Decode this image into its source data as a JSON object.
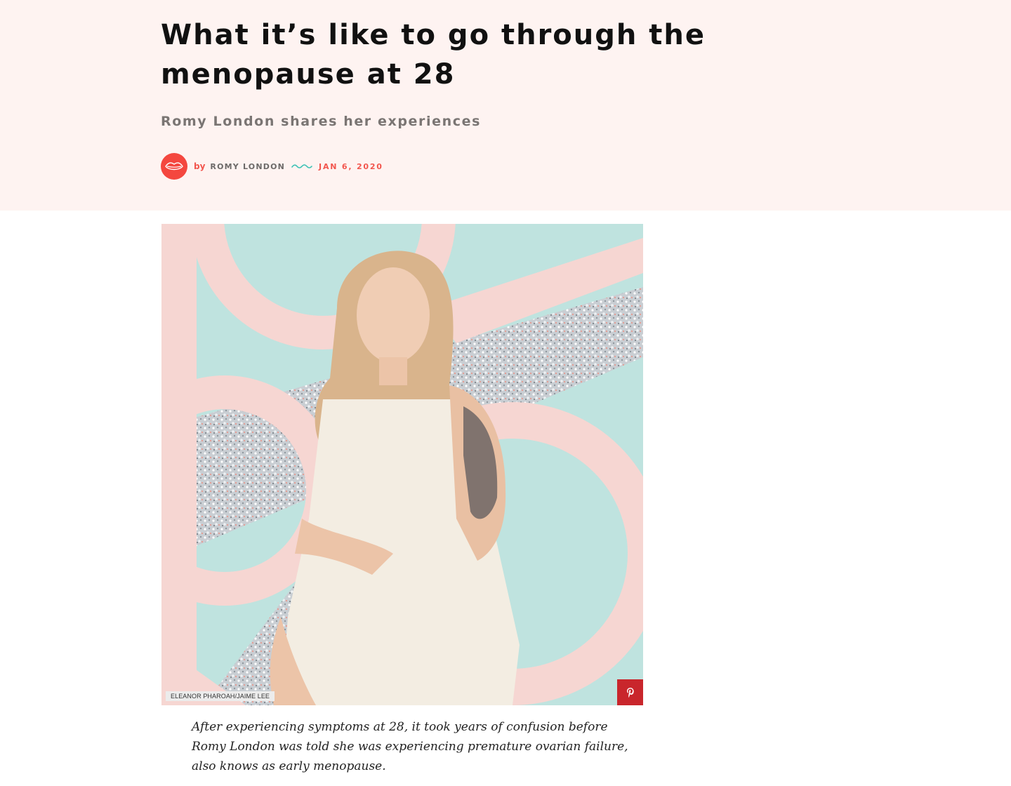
{
  "article": {
    "title": "What it’s like to go through the menopause at 28",
    "subtitle": "Romy London shares her experiences",
    "byline": {
      "by": "by",
      "author": "ROMY LONDON",
      "date": "JAN 6, 2020",
      "avatar_icon": "lips-icon",
      "divider_icon": "squiggle-icon"
    },
    "image": {
      "alt": "Romy London seated in a cream dungaree jumpsuit against a pink and mint graphic background",
      "credit": "ELEANOR PHAROAH/JAIME LEE",
      "pin_icon": "pinterest-icon",
      "pin_label": "Save to Pinterest"
    },
    "standfirst": "After experiencing symptoms at 28, it took years of confusion before Romy London was told she was experiencing premature ovarian failure, also knows as early menopause."
  },
  "colors": {
    "hero_background": "#fef3f1",
    "accent": "#f4473f",
    "squiggle": "#3cc1b4",
    "mint": "#bfe3df",
    "pink": "#f6d6d2",
    "pinterest": "#c9262c"
  }
}
